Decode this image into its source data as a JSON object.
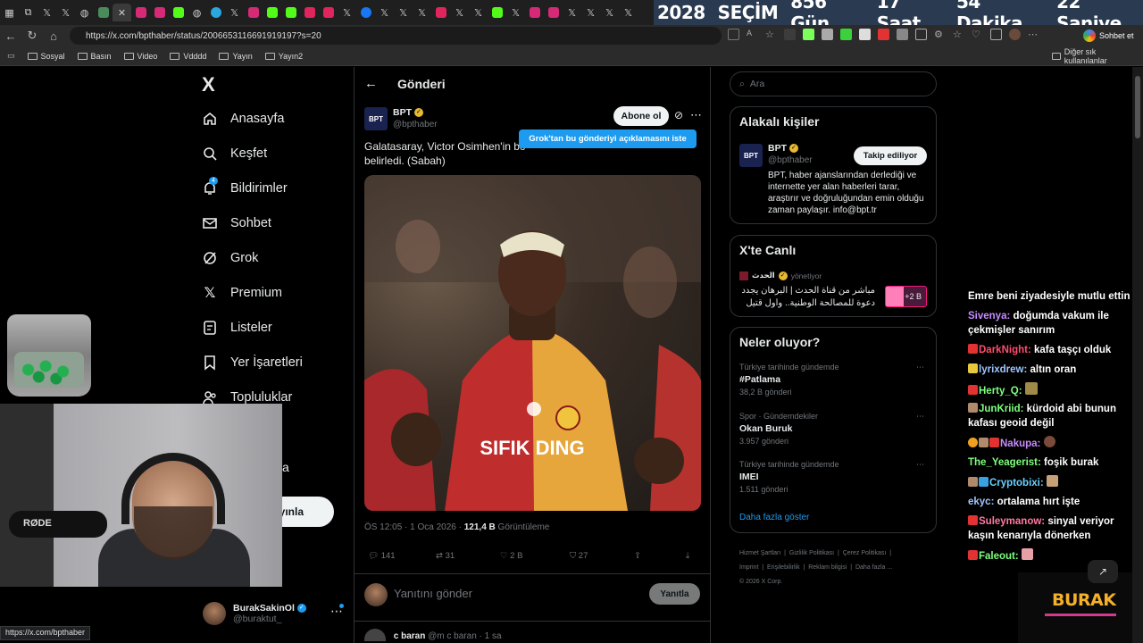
{
  "browser": {
    "countdown": [
      "2028",
      "SEÇİM",
      "856 Gün",
      "17 Saat",
      "54 Dakika",
      "22 Saniye"
    ],
    "url": "https://x.com/bpthaber/status/2006653116691919197?s=20",
    "chat_button": "Sohbet et",
    "bookmarks": [
      "Sosyal",
      "Basın",
      "Video",
      "Vdddd",
      "Yayın",
      "Yayın2"
    ],
    "other_bookmarks": "Diğer sık kullanılanlar",
    "status_url": "https://x.com/bpthaber"
  },
  "nav": {
    "logo": "X",
    "items": [
      {
        "label": "Anasayfa",
        "icon": "home-icon"
      },
      {
        "label": "Keşfet",
        "icon": "search-icon"
      },
      {
        "label": "Bildirimler",
        "icon": "bell-icon"
      },
      {
        "label": "Sohbet",
        "icon": "mail-icon"
      },
      {
        "label": "Grok",
        "icon": "grok-icon"
      },
      {
        "label": "Premium",
        "icon": "x-icon"
      },
      {
        "label": "Listeler",
        "icon": "list-icon"
      },
      {
        "label": "Yer İşaretleri",
        "icon": "bookmark-icon"
      },
      {
        "label": "Topluluklar",
        "icon": "people-icon"
      }
    ],
    "notif_count": "4",
    "partial_label": "a",
    "post_button_partial": "ayınla",
    "account": {
      "name": "BurakSakinOl",
      "handle": "@buraktut_"
    }
  },
  "post": {
    "header": "Gönderi",
    "author": "BPT",
    "handle": "@bpthaber",
    "subscribe": "Abone ol",
    "grok_tooltip": "Grok'tan bu gönderiyi açıklamasını iste",
    "text_line1": "Galatasaray, Victor Osimhen'in bo",
    "text_line2": "belirledi. (Sabah)",
    "meta_time": "ÖS 12:05 · 1 Oca 2026 · ",
    "meta_views": "121,4 B",
    "meta_views_label": " Görüntüleme",
    "stats": {
      "replies": "141",
      "reposts": "31",
      "likes": "2 B",
      "bookmarks": "27"
    },
    "reply_placeholder": "Yanıtını gönder",
    "reply_button": "Yanıtla",
    "next_reply": {
      "name": "c baran",
      "handle": "@m c baran",
      "time": "· 1 sa"
    },
    "image_jersey_text": "SIFIK DING"
  },
  "right": {
    "search_placeholder": "Ara",
    "related_title": "Alakalı kişiler",
    "related": {
      "name": "BPT",
      "handle": "@bpthaber",
      "follow": "Takip ediliyor",
      "bio": "BPT, haber ajanslarından derlediği ve internette yer alan haberleri tarar, araştırır ve doğruluğundan emin olduğu zaman paylaşır. info@bpt.tr"
    },
    "live_title": "X'te Canlı",
    "live": {
      "host": "الحدث",
      "role": "yönetiyor",
      "text_line1": "مباشر من قناة الحدث | البرهان يجدد",
      "text_line2": "دعوة للمصالحة الوطنية.. وأول قتيل",
      "count": "+2 B"
    },
    "happening_title": "Neler oluyor?",
    "trends": [
      {
        "context": "Türkiye tarihinde gündemde",
        "name": "#Patlama",
        "count": "38,2 B gönderi"
      },
      {
        "context": "Spor · Gündemdekiler",
        "name": "Okan Buruk",
        "count": "3.957 gönderi"
      },
      {
        "context": "Türkiye tarihinde gündemde",
        "name": "IMEI",
        "count": "1.511 gönderi"
      }
    ],
    "show_more": "Daha fazla göster",
    "footer_line1": [
      "Hizmet Şartları",
      "Gizlilik Politikası",
      "Çerez Politikası"
    ],
    "footer_line2": [
      "Imprint",
      "Erişilebilirlik",
      "Reklam bilgisi",
      "Daha fazla ..."
    ],
    "copyright": "© 2026 X Corp."
  },
  "chat": [
    {
      "user": "",
      "msg": "Emre beni ziyadesiyle mutlu ettin",
      "color": "#ffffff"
    },
    {
      "user": "Sivenya:",
      "msg": " doğumda vakum ile çekmişler sanırım",
      "color": "#c88bff"
    },
    {
      "user": "DarkNight:",
      "msg": " kafa taşçı olduk",
      "color": "#ff4d6d"
    },
    {
      "user": "lyrixdrew:",
      "msg": " altın oran",
      "color": "#9fc5ff"
    },
    {
      "user": "Herty_Q:",
      "msg": "",
      "color": "#7dff7d"
    },
    {
      "user": "JunKriid:",
      "msg": " kürdoid abi bunun kafası geoid değil",
      "color": "#7dff7d"
    },
    {
      "user": "Nakupa:",
      "msg": "",
      "color": "#c88bff"
    },
    {
      "user": "The_Yeagerist:",
      "msg": " foşik burak",
      "color": "#7dff7d"
    },
    {
      "user": "Cryptobixi:",
      "msg": "",
      "color": "#6ad0ff"
    },
    {
      "user": "ekyc:",
      "msg": " ortalama hırt işte",
      "color": "#9fc5ff"
    },
    {
      "user": "Suleymanow:",
      "msg": " sinyal veriyor kaşın kenarıyla dönerken",
      "color": "#ff7aa2"
    },
    {
      "user": "Faleout:",
      "msg": "",
      "color": "#7dff7d"
    }
  ],
  "stream": {
    "brand": "BURAK",
    "mic_brand": "RØDE"
  },
  "colors": {
    "accent": "#1d9bf0",
    "gold_verified": "#e8b931",
    "countdown_bg": "#2a3a50"
  }
}
